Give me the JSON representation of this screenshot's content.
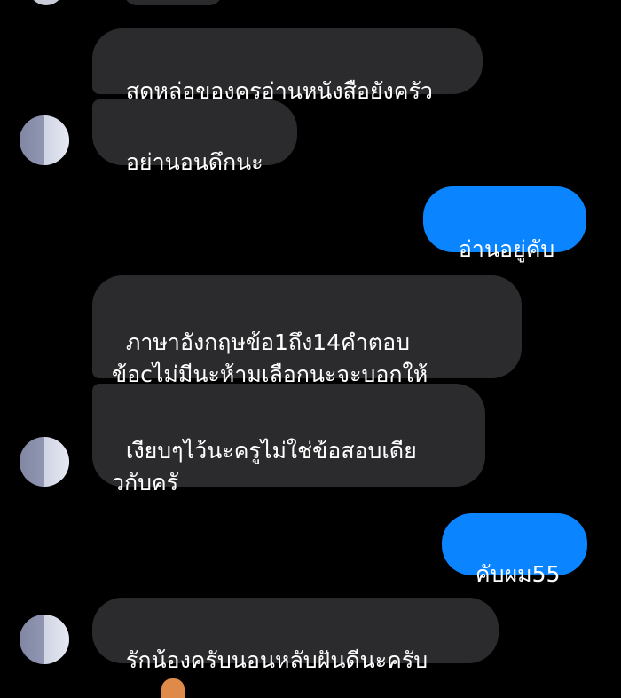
{
  "colors": {
    "background": "#000000",
    "incoming_bubble": "#2b2b2d",
    "outgoing_bubble": "#0a84ff",
    "text": "#ffffff"
  },
  "messages": [
    {
      "id": "m1",
      "direction": "incoming",
      "text": "สุดหล่อของครูอ่านหนังสือยังครัว"
    },
    {
      "id": "m2",
      "direction": "incoming",
      "text": "อย่านอนดึกนะ"
    },
    {
      "id": "m3",
      "direction": "outgoing",
      "text": "อ่านอยู่คับ"
    },
    {
      "id": "m4",
      "direction": "incoming",
      "text": "ภาษาอังกฤษข้อ1ถึง14คำตอบ\nข้อcไม่มีนะห้ามเลือกนะจะบอกให้"
    },
    {
      "id": "m5",
      "direction": "incoming",
      "text": "เงียบๆไว้นะครูไม่ใช่ข้อสอบเดีย\nวกับครั"
    },
    {
      "id": "m6",
      "direction": "outgoing",
      "text": "คับผม55"
    },
    {
      "id": "m7",
      "direction": "incoming",
      "text": "รักน้องครับนอนหลับฝันดีนะครับ"
    }
  ],
  "avatars": [
    {
      "icon": "blurred-profile-picture"
    },
    {
      "icon": "blurred-profile-picture"
    },
    {
      "icon": "blurred-profile-picture"
    }
  ]
}
